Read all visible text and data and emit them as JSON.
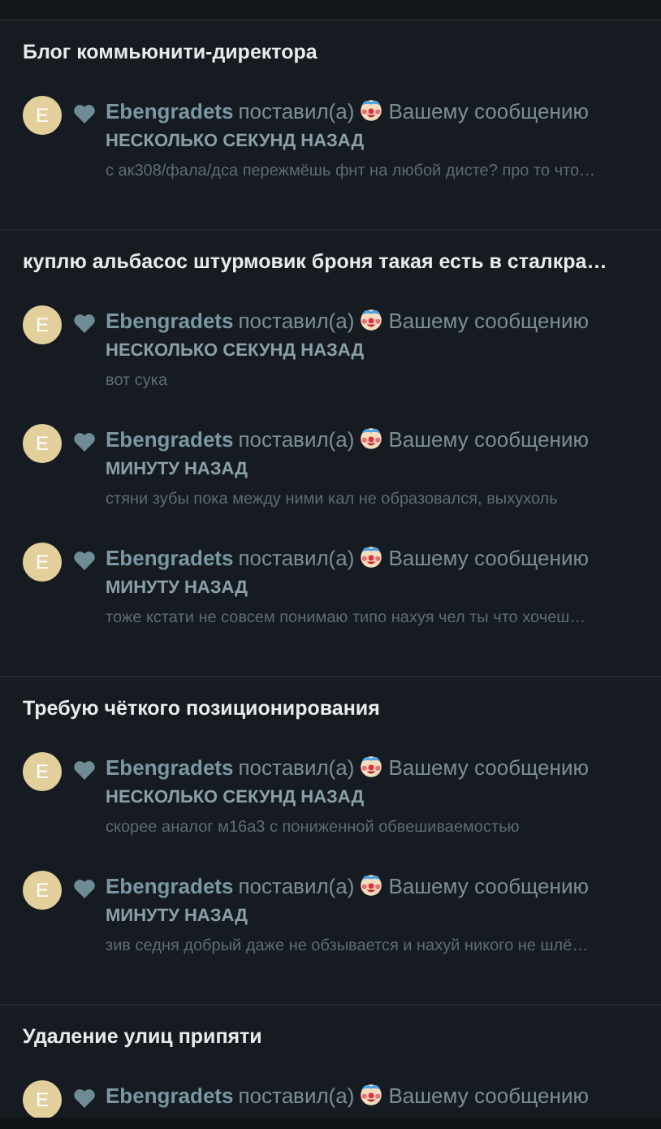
{
  "threads": [
    {
      "title": "Блог коммьюнити-директора",
      "notifications": [
        {
          "avatar": "E",
          "user": "Ebengradets",
          "action": "поставил(а)",
          "target": "Вашему сообщению",
          "time": "НЕСКОЛЬКО СЕКУНД НАЗАД",
          "snippet": "с ак308/фала/дса пережмёшь фнт на любой дисте? про то что…"
        }
      ]
    },
    {
      "title": "куплю альбасос штурмовик броня такая есть в сталкра…",
      "notifications": [
        {
          "avatar": "E",
          "user": "Ebengradets",
          "action": "поставил(а)",
          "target": "Вашему сообщению",
          "time": "НЕСКОЛЬКО СЕКУНД НАЗАД",
          "snippet": "вот сука"
        },
        {
          "avatar": "E",
          "user": "Ebengradets",
          "action": "поставил(а)",
          "target": "Вашему сообщению",
          "time": "МИНУТУ НАЗАД",
          "snippet": "стяни зубы пока между ними кал не образовался, выхухоль"
        },
        {
          "avatar": "E",
          "user": "Ebengradets",
          "action": "поставил(а)",
          "target": "Вашему сообщению",
          "time": "МИНУТУ НАЗАД",
          "snippet": "тоже кстати не совсем понимаю типо нахуя чел ты что хочеш…"
        }
      ]
    },
    {
      "title": "Требую чёткого позиционирования",
      "notifications": [
        {
          "avatar": "E",
          "user": "Ebengradets",
          "action": "поставил(а)",
          "target": "Вашему сообщению",
          "time": "НЕСКОЛЬКО СЕКУНД НАЗАД",
          "snippet": "скорее аналог м16а3 с пониженной обвешиваемостью"
        },
        {
          "avatar": "E",
          "user": "Ebengradets",
          "action": "поставил(а)",
          "target": "Вашему сообщению",
          "time": "МИНУТУ НАЗАД",
          "snippet": "зив седня добрый даже не обзывается и нахуй никого не шлё…"
        }
      ]
    },
    {
      "title": "Удаление улиц припяти",
      "notifications": [
        {
          "avatar": "E",
          "user": "Ebengradets",
          "action": "поставил(а)",
          "target": "Вашему сообщению"
        }
      ]
    }
  ]
}
